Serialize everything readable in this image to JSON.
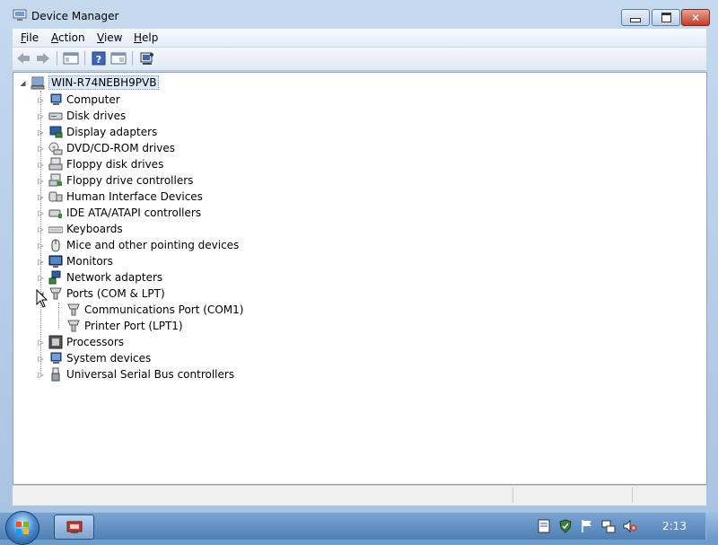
{
  "window": {
    "title": "Device Manager",
    "caption_buttons": [
      "minimize-icon",
      "maximize-icon",
      "close-icon"
    ]
  },
  "menubar": {
    "items": [
      {
        "label": "File",
        "mnemonic": "F"
      },
      {
        "label": "Action",
        "mnemonic": "A"
      },
      {
        "label": "View",
        "mnemonic": "V"
      },
      {
        "label": "Help",
        "mnemonic": "H"
      }
    ]
  },
  "toolbar": {
    "buttons": [
      "back-arrow-icon",
      "forward-arrow-icon",
      "show-hide-console-tree-icon",
      "help-icon",
      "properties-icon",
      "scan-hardware-icon"
    ]
  },
  "tree": {
    "root": "WIN-R74NEBH9PVB",
    "categories": [
      {
        "label": "Computer",
        "icon": "computer-icon",
        "expanded": false
      },
      {
        "label": "Disk drives",
        "icon": "disk-drive-icon",
        "expanded": false
      },
      {
        "label": "Display adapters",
        "icon": "display-adapter-icon",
        "expanded": false
      },
      {
        "label": "DVD/CD-ROM drives",
        "icon": "dvd-drive-icon",
        "expanded": false
      },
      {
        "label": "Floppy disk drives",
        "icon": "floppy-drive-icon",
        "expanded": false
      },
      {
        "label": "Floppy drive controllers",
        "icon": "floppy-controller-icon",
        "expanded": false
      },
      {
        "label": "Human Interface Devices",
        "icon": "hid-icon",
        "expanded": false
      },
      {
        "label": "IDE ATA/ATAPI controllers",
        "icon": "ide-controller-icon",
        "expanded": false
      },
      {
        "label": "Keyboards",
        "icon": "keyboard-icon",
        "expanded": false
      },
      {
        "label": "Mice and other pointing devices",
        "icon": "mouse-icon",
        "expanded": false
      },
      {
        "label": "Monitors",
        "icon": "monitor-icon",
        "expanded": false
      },
      {
        "label": "Network adapters",
        "icon": "network-adapter-icon",
        "expanded": false
      },
      {
        "label": "Ports (COM & LPT)",
        "icon": "port-icon",
        "expanded": true,
        "children": [
          "Communications Port (COM1)",
          "Printer Port (LPT1)"
        ]
      },
      {
        "label": "Processors",
        "icon": "processor-icon",
        "expanded": false
      },
      {
        "label": "System devices",
        "icon": "system-device-icon",
        "expanded": false
      },
      {
        "label": "Universal Serial Bus controllers",
        "icon": "usb-icon",
        "expanded": false
      }
    ]
  },
  "taskbar": {
    "start_icon": "windows-start-icon",
    "task_icon": "device-manager-icon",
    "tray_icons": [
      "document-icon",
      "security-shield-icon",
      "action-center-flag-icon",
      "network-icon",
      "volume-muted-icon"
    ],
    "clock": "2:13"
  }
}
